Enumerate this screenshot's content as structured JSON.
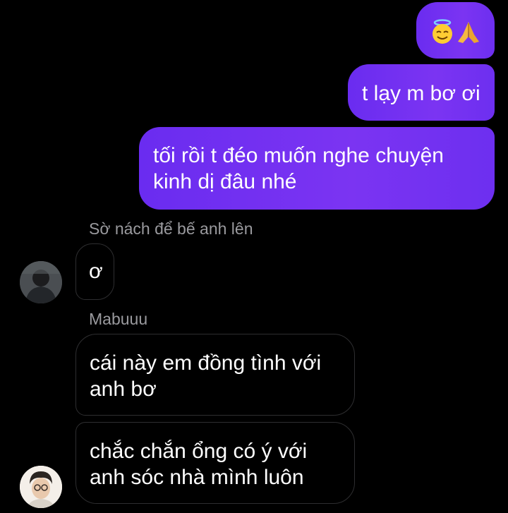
{
  "conversation": {
    "outgoing": [
      {
        "text": "😇🙏"
      },
      {
        "text": "t lạy m bơ ơi"
      },
      {
        "text": "tối rồi t đéo muốn nghe chuyện kinh dị đâu nhé"
      }
    ],
    "incoming_groups": [
      {
        "sender_name": "Sờ nách để bế anh lên",
        "messages": [
          "ơ"
        ]
      },
      {
        "sender_name": "Mabuuu",
        "messages": [
          "cái này em đồng tình với anh bơ",
          "chắc chắn ổng có ý với anh sóc nhà mình luôn"
        ]
      }
    ]
  },
  "colors": {
    "background": "#000000",
    "outgoing_bubble": "#7b34f2",
    "incoming_border": "#2e2e30",
    "sender_name": "#9a9a9e",
    "text": "#ffffff"
  }
}
